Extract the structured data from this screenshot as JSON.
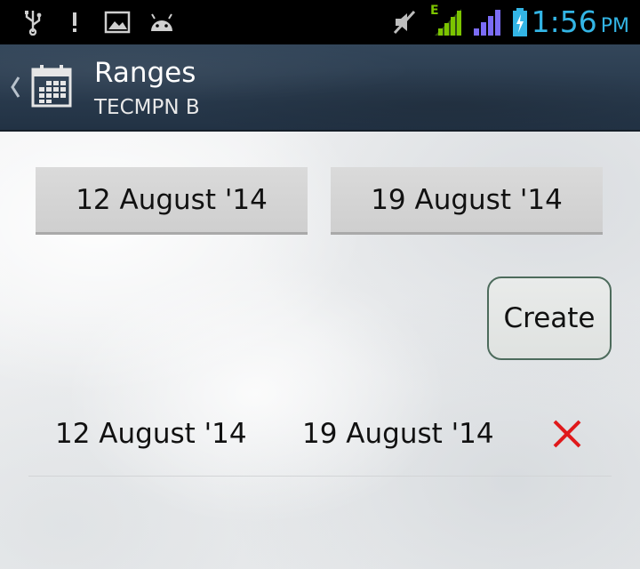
{
  "status_bar": {
    "time": "1:56",
    "ampm": "PM",
    "icons": [
      "usb-icon",
      "alert-icon",
      "image-icon",
      "android-icon",
      "mute-icon",
      "signal-e-icon",
      "signal-icon",
      "battery-charging-icon"
    ],
    "colors": {
      "clock": "#33b5e5",
      "signal_green": "#7cc400",
      "signal_purple": "#7b6cf6",
      "battery": "#33b5e5"
    },
    "network_label": "E"
  },
  "action_bar": {
    "title": "Ranges",
    "subtitle": "TECMPN B",
    "icons": [
      "back-caret-icon",
      "calendar-icon"
    ]
  },
  "main": {
    "from_date_label": "12 August '14",
    "to_date_label": "19 August '14",
    "create_label": "Create",
    "ranges": [
      {
        "from": "12 August '14",
        "to": "19 August '14",
        "delete_icon": "delete-x-icon"
      }
    ],
    "colors": {
      "delete": "#e0191b",
      "create_border": "#4d6b5c"
    }
  }
}
